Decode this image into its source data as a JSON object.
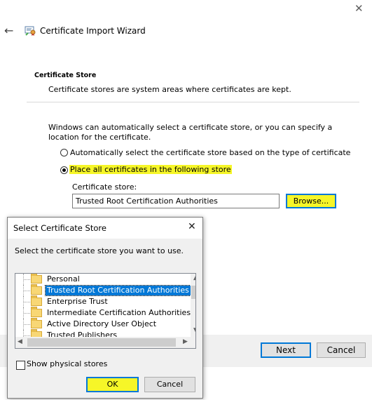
{
  "wizard": {
    "title": "Certificate Import Wizard",
    "section_title": "Certificate Store",
    "section_desc": "Certificate stores are system areas where certificates are kept.",
    "explain": "Windows can automatically select a certificate store, or you can specify a location for the certificate.",
    "radio_auto_label": "Automatically select the certificate store based on the type of certificate",
    "radio_place_label": "Place all certificates in the following store",
    "store_label": "Certificate store:",
    "store_value": "Trusted Root Certification Authorities",
    "browse_label": "Browse...",
    "next_label": "Next",
    "cancel_label": "Cancel",
    "close_glyph": "✕",
    "back_glyph": "←"
  },
  "dialog": {
    "title": "Select Certificate Store",
    "close_glyph": "✕",
    "instruction": "Select the certificate store you want to use.",
    "stores": [
      "Personal",
      "Trusted Root Certification Authorities",
      "Enterprise Trust",
      "Intermediate Certification Authorities",
      "Active Directory User Object",
      "Trusted Publishers"
    ],
    "selected_store": "Trusted Root Certification Authorities",
    "show_physical_label": "Show physical stores",
    "show_physical_checked": false,
    "ok_label": "OK",
    "cancel_label": "Cancel"
  },
  "colors": {
    "highlight": "#f6f628",
    "accent": "#0078d7"
  }
}
